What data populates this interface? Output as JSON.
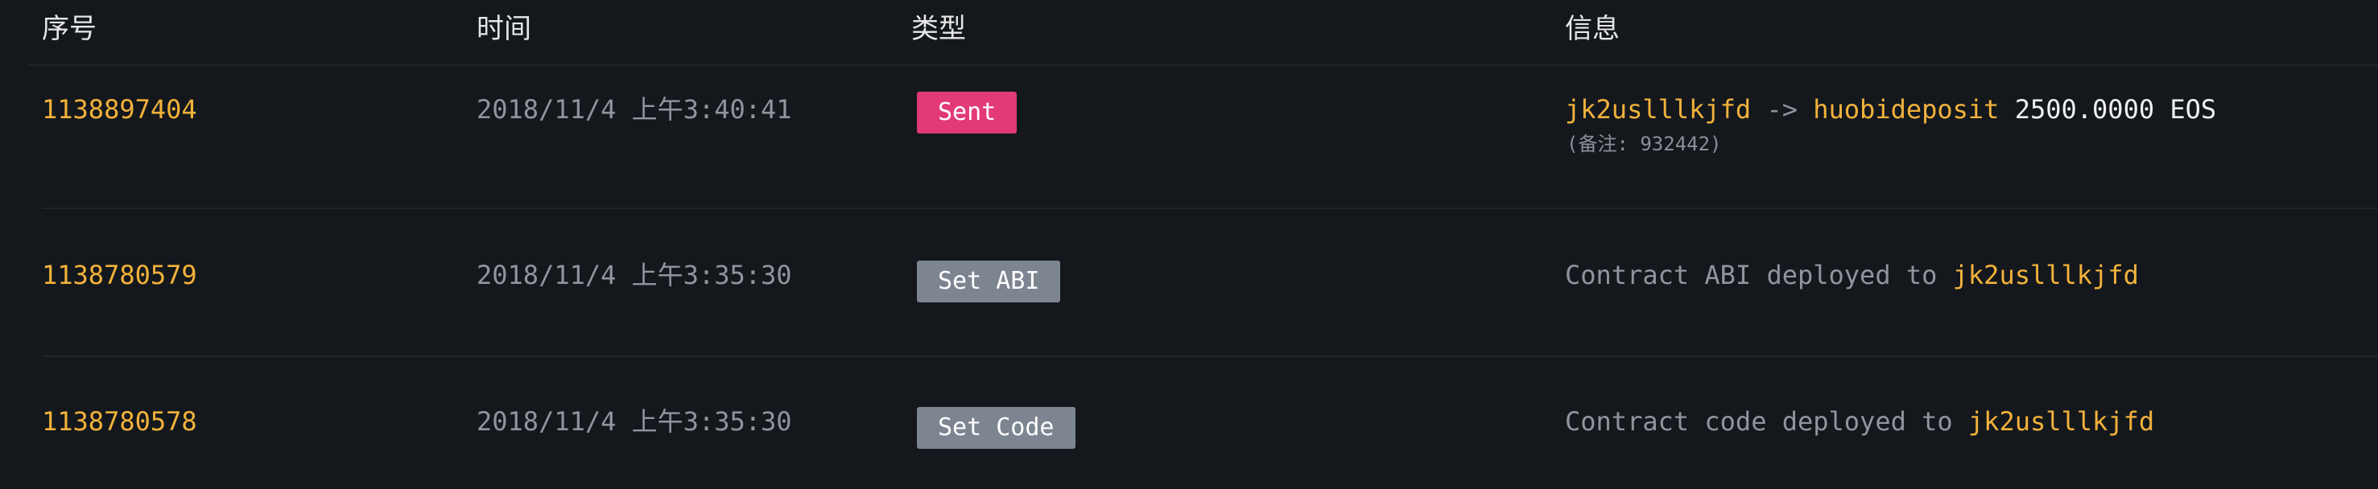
{
  "columns": {
    "seq": "序号",
    "time": "时间",
    "type": "类型",
    "info": "信息"
  },
  "rows": [
    {
      "seq": "1138897404",
      "time": "2018/11/4 上午3:40:41",
      "type": "Sent",
      "type_color": "#e23a78",
      "info": {
        "from": "jk2uslllkjfd",
        "arrow": "->",
        "to": "huobideposit",
        "amount": "2500.0000 EOS",
        "memo": "(备注: 932442)"
      }
    },
    {
      "seq": "1138780579",
      "time": "2018/11/4 上午3:35:30",
      "type": "Set ABI",
      "type_color": "#7d8591",
      "info": {
        "text": "Contract ABI deployed to",
        "account": "jk2uslllkjfd"
      }
    },
    {
      "seq": "1138780578",
      "time": "2018/11/4 上午3:35:30",
      "type": "Set Code",
      "type_color": "#7d8591",
      "info": {
        "text": "Contract code deployed to",
        "account": "jk2uslllkjfd"
      }
    }
  ],
  "colors": {
    "background": "#14181d",
    "account": "#f2b23a",
    "muted_text": "#8f959c",
    "header_text": "#e6e6e6"
  }
}
